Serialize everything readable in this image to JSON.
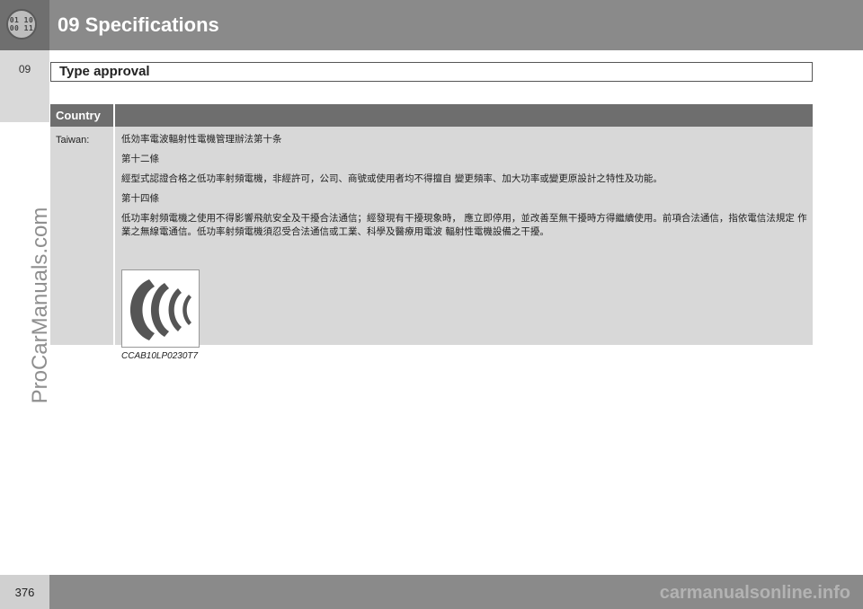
{
  "header": {
    "chapter_title": "09 Specifications",
    "icon_label": "chapter-icon",
    "icon_text_top": "01 10",
    "icon_text_bottom": "00 11"
  },
  "side_tab": {
    "chapter_number": "09"
  },
  "section": {
    "title": "Type approval"
  },
  "table": {
    "header_country": "Country",
    "rows": [
      {
        "country": "Taiwan:",
        "lines": [
          "低効率電波輻射性電機管理辦法第十条",
          "第十二條",
          "經型式認證合格之低功率射頻電機，非經許可，公司、商號或使用者均不得擅自  變更頻率、加大功率或變更原設計之特性及功能。",
          "第十四條",
          "低功率射頻電機之使用不得影響飛航安全及干擾合法通信；經發現有干擾現象時，  應立即停用，並改善至無干擾時方得繼續使用。前項合法通信，指依電信法規定  作業之無線電通信。低功率射頻電機須忍受合法通信或工業、科學及醫療用電波  輻射性電機設備之干擾。"
        ],
        "approval_mark_icon": "ncc-approval-mark-icon",
        "approval_code": "CCAB10LP0230T7"
      }
    ]
  },
  "footer": {
    "page_number": "376",
    "watermark": "carmanualsonline.info"
  },
  "side_watermark": "ProCarManuals.com",
  "colors": {
    "header_bg": "#8a8a8a",
    "table_header_bg": "#6e6e6e",
    "table_body_bg": "#d8d8d8"
  }
}
